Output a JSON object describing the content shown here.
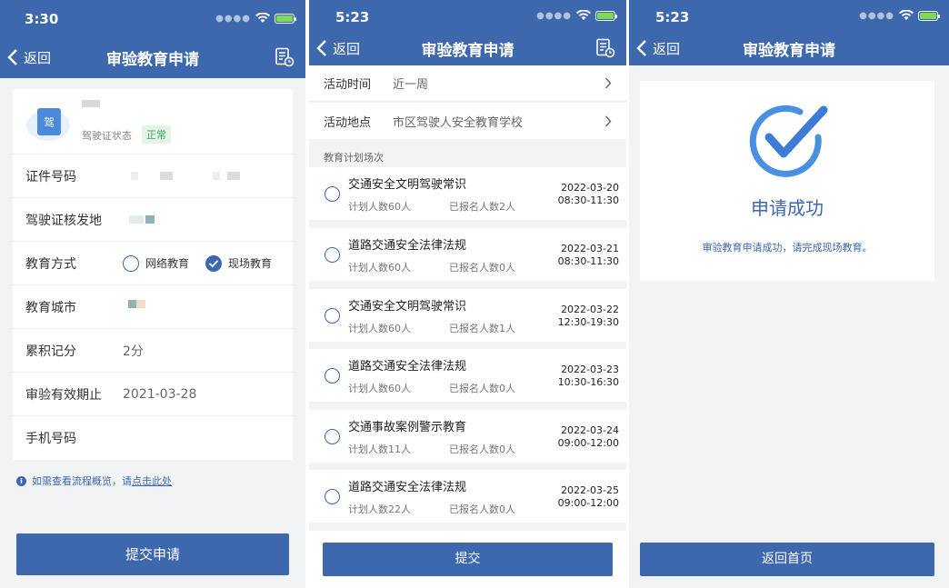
{
  "screen1": {
    "time": "3:30",
    "nav": {
      "back": "返回",
      "title": "审验教育申请"
    },
    "license": {
      "status_label": "驾驶证状态",
      "status_value": "正常",
      "icon_char": "驾"
    },
    "fields": {
      "id_number": "证件号码",
      "issuing": "驾驶证核发地",
      "method": "教育方式",
      "city": "教育城市",
      "points": "累积记分",
      "points_value": "2分",
      "expiry": "审验有效期止",
      "expiry_value": "2021-03-28",
      "phone": "手机号码"
    },
    "method_options": {
      "online": "网络教育",
      "onsite": "现场教育",
      "selected": "onsite"
    },
    "tip": {
      "text": "如需查看流程概览，请",
      "link": "点击此处"
    },
    "submit": "提交申请"
  },
  "screen2": {
    "time": "5:23",
    "nav": {
      "back": "返回",
      "title": "审验教育申请"
    },
    "filters": {
      "time_label": "活动时间",
      "time_value": "近一周",
      "place_label": "活动地点",
      "place_value": "市区驾驶人安全教育学校"
    },
    "section_label": "教育计划场次",
    "sessions": [
      {
        "title": "交通安全文明驾驶常识",
        "plan": "计划人数60人",
        "registered": "已报名人数2人",
        "date": "2022-03-20",
        "time": "08:30-11:30"
      },
      {
        "title": "道路交通安全法律法规",
        "plan": "计划人数60人",
        "registered": "已报名人数0人",
        "date": "2022-03-21",
        "time": "08:30-11:30"
      },
      {
        "title": "交通安全文明驾驶常识",
        "plan": "计划人数60人",
        "registered": "已报名人数1人",
        "date": "2022-03-22",
        "time": "12:30-19:30"
      },
      {
        "title": "道路交通安全法律法规",
        "plan": "计划人数60人",
        "registered": "已报名人数0人",
        "date": "2022-03-23",
        "time": "10:30-16:30"
      },
      {
        "title": "交通事故案例警示教育",
        "plan": "计划人数11人",
        "registered": "已报名人数0人",
        "date": "2022-03-24",
        "time": "09:00-12:00"
      },
      {
        "title": "道路交通安全法律法规",
        "plan": "计划人数22人",
        "registered": "已报名人数0人",
        "date": "2022-03-25",
        "time": "09:00-12:00"
      }
    ],
    "submit": "提交"
  },
  "screen3": {
    "time": "5:23",
    "nav": {
      "back": "返回",
      "title": "审验教育申请"
    },
    "result_title": "申请成功",
    "result_message": "审验教育申请成功，请完成现场教育。",
    "home_button": "返回首页"
  },
  "colors": {
    "primary": "#3d68ad",
    "background": "#f2f3f5",
    "success": "#3aa35a",
    "battery": "#7ed957"
  }
}
